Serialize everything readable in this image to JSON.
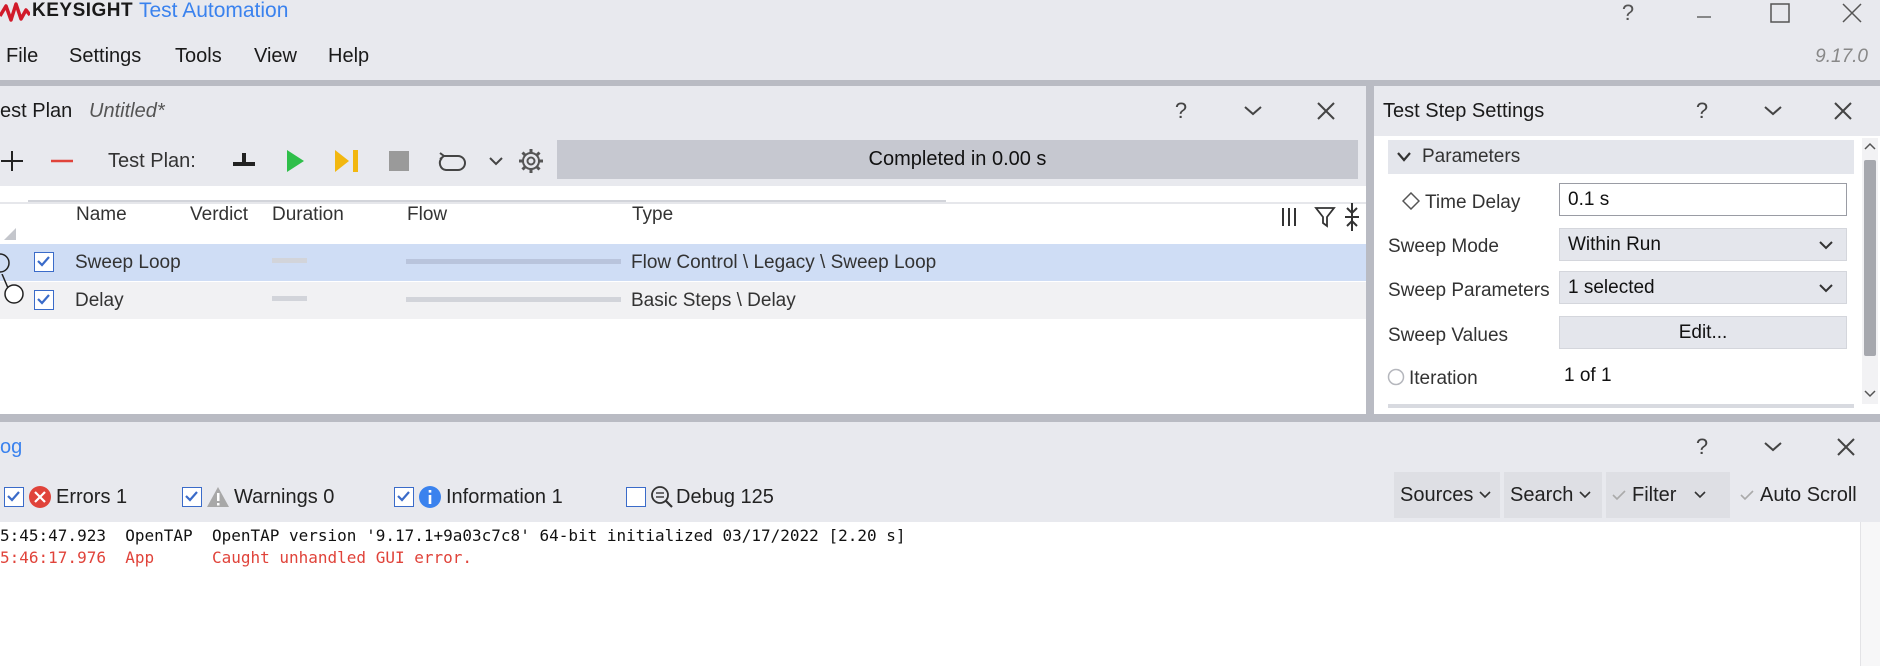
{
  "titlebar": {
    "brand": "KEYSIGHT",
    "app_title": "Test Automation",
    "brand_color": "#d11a2a",
    "accent": "#3a82ee"
  },
  "menu": {
    "items": [
      "File",
      "Settings",
      "Tools",
      "View",
      "Help"
    ],
    "version": "9.17.0"
  },
  "test_plan": {
    "panel_title": "est Plan",
    "file_name": "Untitled*",
    "toolbar_label": "Test Plan:",
    "status": "Completed in 0.00 s",
    "columns": [
      "Name",
      "Verdict",
      "Duration",
      "Flow",
      "Type"
    ],
    "rows": [
      {
        "checked": true,
        "name": "Sweep Loop",
        "type": "Flow Control \\ Legacy \\ Sweep Loop"
      },
      {
        "checked": true,
        "name": "Delay",
        "type": "Basic Steps \\ Delay"
      }
    ]
  },
  "settings": {
    "panel_title": "Test Step Settings",
    "group": "Parameters",
    "time_delay_label": "Time Delay",
    "time_delay_value": "0.1 s",
    "sweep_mode_label": "Sweep Mode",
    "sweep_mode_value": "Within Run",
    "sweep_params_label": "Sweep Parameters",
    "sweep_params_value": "1 selected",
    "sweep_values_label": "Sweep Values",
    "edit_button": "Edit...",
    "iteration_label": "Iteration",
    "iteration_value": "1 of 1"
  },
  "log": {
    "panel_title": "og",
    "filters": {
      "errors": "Errors 1",
      "warnings": "Warnings 0",
      "information": "Information 1",
      "debug": "Debug 125"
    },
    "buttons": {
      "sources": "Sources",
      "search": "Search",
      "filter": "Filter",
      "autoscroll": "Auto Scroll"
    },
    "entries": [
      {
        "time": "5:45:47.923",
        "source": "OpenTAP",
        "message": "OpenTAP version '9.17.1+9a03c7c8' 64-bit initialized 03/17/2022 [2.20 s]",
        "level": "info"
      },
      {
        "time": "5:46:17.976",
        "source": "App",
        "message": "Caught unhandled GUI error.",
        "level": "error"
      }
    ],
    "error_color": "#e0433a"
  }
}
